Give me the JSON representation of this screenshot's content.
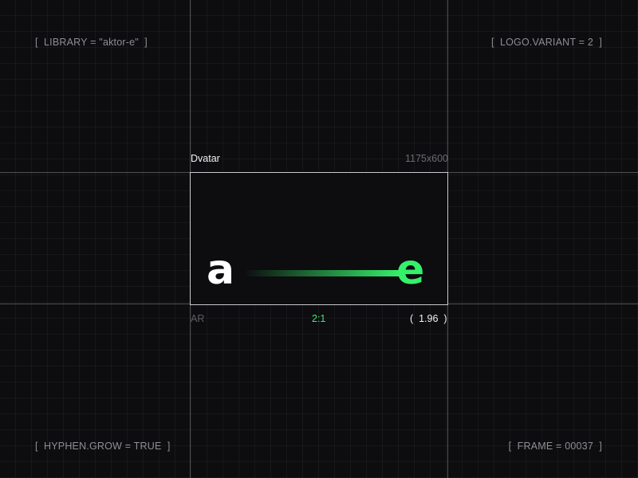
{
  "corners": {
    "top_left": "[  LIBRARY = \"aktor-e\"  ]",
    "top_right": "[  LOGO.VARIANT = 2  ]",
    "bottom_left": "[  HYPHEN.GROW = TRUE  ]",
    "bottom_right": "[  FRAME = 00037  ]"
  },
  "frame": {
    "title": "Dvatar",
    "dimensions": "1175x600",
    "logo": {
      "left_glyph": "a",
      "right_glyph": "e"
    }
  },
  "aspect": {
    "label": "AR",
    "ratio": "2:1",
    "value": "(  1.96  )"
  },
  "colors": {
    "background": "#0d0c0f",
    "accent": "#35f06b",
    "frame_border": "#c9c8cc",
    "text_light": "#f2f2f2",
    "text_muted": "#8f8e93"
  }
}
